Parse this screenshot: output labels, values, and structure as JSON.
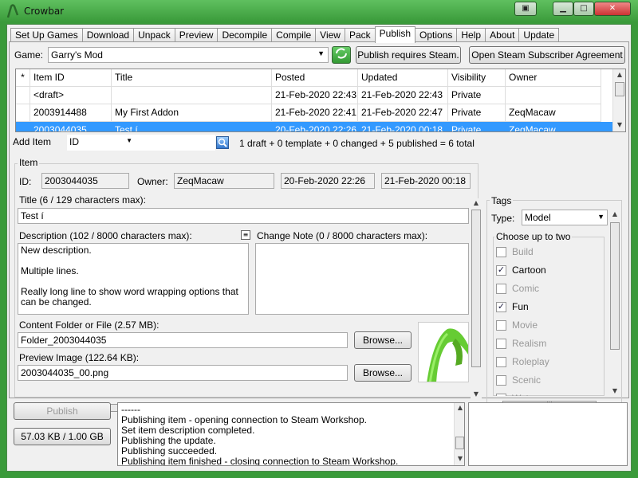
{
  "window": {
    "title": "Crowbar"
  },
  "tabs": [
    "Set Up Games",
    "Download",
    "Unpack",
    "Preview",
    "Decompile",
    "Compile",
    "View",
    "Pack",
    "Publish",
    "Options",
    "Help",
    "About",
    "Update"
  ],
  "game": {
    "label": "Game:",
    "value": "Garry's Mod",
    "refresh_icon": "refresh-icon"
  },
  "buttons": {
    "publish_requires_steam": "Publish requires Steam.",
    "open_agreement": "Open Steam Subscriber Agreement",
    "add_item": "Add Item",
    "browse": "Browse...",
    "publish": "Publish",
    "quota": "57.03 KB / 1.00 GB"
  },
  "grid": {
    "headers": [
      "*",
      "Item ID",
      "Title",
      "Posted",
      "Updated",
      "Visibility",
      "Owner"
    ],
    "rows": [
      {
        "star": "",
        "id": "<draft>",
        "title": "",
        "posted": "21-Feb-2020 22:43",
        "updated": "21-Feb-2020 22:43",
        "visibility": "Private",
        "owner": ""
      },
      {
        "star": "",
        "id": "2003914488",
        "title": "My First Addon",
        "posted": "21-Feb-2020 22:41",
        "updated": "21-Feb-2020 22:47",
        "visibility": "Private",
        "owner": "ZeqMacaw"
      },
      {
        "star": "",
        "id": "2003044035",
        "title": "Test í",
        "posted": "20-Feb-2020 22:26",
        "updated": "21-Feb-2020 00:18",
        "visibility": "Private",
        "owner": "ZeqMacaw"
      }
    ]
  },
  "search": {
    "field": "ID",
    "value": "",
    "summary": "1 draft + 0 template + 0 changed + 5 published = 6 total"
  },
  "item": {
    "group_label": "Item",
    "id_label": "ID:",
    "id": "2003044035",
    "owner_label": "Owner:",
    "owner": "ZeqMacaw",
    "posted": "20-Feb-2020 22:26",
    "updated": "21-Feb-2020 00:18",
    "title_label": "Title (6 / 129 characters max):",
    "title": "Test í",
    "description_label": "Description (102 / 8000 characters max):",
    "description_lines": [
      "New description.",
      "",
      "Multiple lines.",
      "",
      "Really long line to show word wrapping options that can be changed."
    ],
    "change_note_label": "Change Note (0 / 8000 characters max):",
    "change_note": "",
    "content_label": "Content Folder or File (2.57 MB):",
    "content": "Folder_2003044035",
    "preview_label": "Preview Image (122.64 KB):",
    "preview": "2003044035_00.png"
  },
  "tags": {
    "group_label": "Tags",
    "type_label": "Type:",
    "type_value": "Model",
    "choose_label": "Choose up to two",
    "items": [
      {
        "label": "Build",
        "checked": false,
        "enabled": false
      },
      {
        "label": "Cartoon",
        "checked": true,
        "enabled": true
      },
      {
        "label": "Comic",
        "checked": false,
        "enabled": false
      },
      {
        "label": "Fun",
        "checked": true,
        "enabled": true
      },
      {
        "label": "Movie",
        "checked": false,
        "enabled": false
      },
      {
        "label": "Realism",
        "checked": false,
        "enabled": false
      },
      {
        "label": "Roleplay",
        "checked": false,
        "enabled": false
      },
      {
        "label": "Scenic",
        "checked": false,
        "enabled": false
      },
      {
        "label": "Water",
        "checked": false,
        "enabled": false
      }
    ]
  },
  "log": {
    "lines": [
      "------",
      "Publishing item - opening connection to Steam Workshop.",
      "Set item description completed.",
      "Publishing the update.",
      "Publishing succeeded.",
      "Publishing item finished - closing connection to Steam Workshop."
    ]
  },
  "colors": {
    "selection": "#3399ff",
    "title_bar": "#3a9a3a"
  }
}
